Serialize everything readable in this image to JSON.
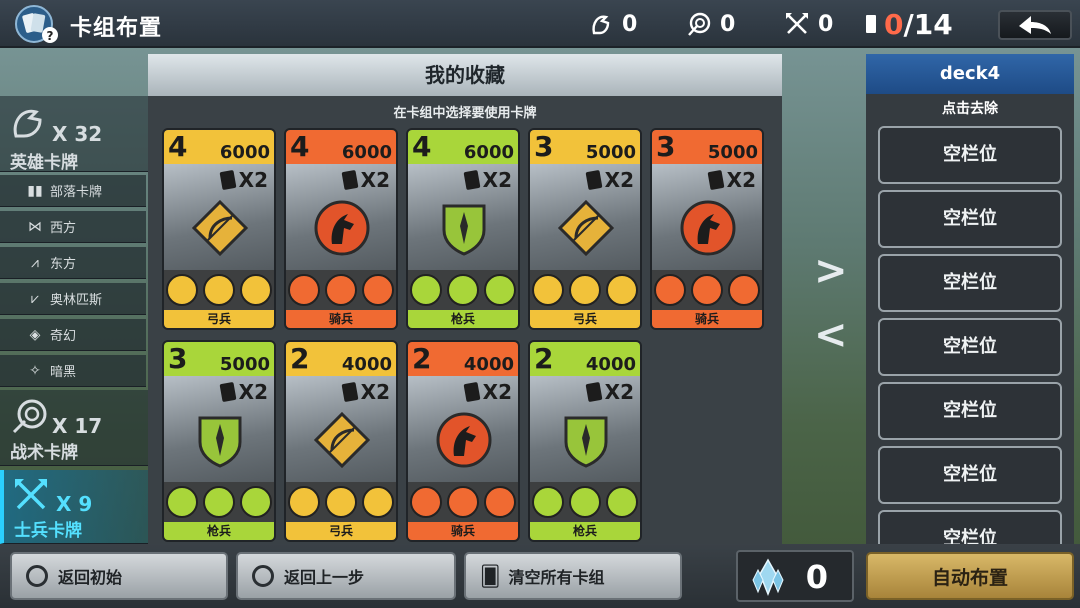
{
  "header": {
    "title": "卡组布置",
    "stats": [
      {
        "icon": "hero-icon",
        "value": "0"
      },
      {
        "icon": "tactic-icon",
        "value": "0"
      },
      {
        "icon": "soldier-icon",
        "value": "0"
      }
    ],
    "deck_count": {
      "current": "0",
      "total": "/14"
    }
  },
  "sidebar": {
    "hero": {
      "count": "X 32",
      "label": "英雄卡牌"
    },
    "factions": [
      {
        "icon": "tribe-icon",
        "label": "部落卡牌"
      },
      {
        "icon": "west-icon",
        "label": "西方"
      },
      {
        "icon": "east-icon",
        "label": "东方"
      },
      {
        "icon": "olympus-icon",
        "label": "奥林匹斯"
      },
      {
        "icon": "fantasy-icon",
        "label": "奇幻"
      },
      {
        "icon": "dark-icon",
        "label": "暗黑"
      }
    ],
    "tactic": {
      "count": "X 17",
      "label": "战术卡牌"
    },
    "soldier": {
      "count": "X 9",
      "label": "士兵卡牌"
    }
  },
  "collection": {
    "title": "我的收藏",
    "subtitle": "在卡组中选择要使用卡牌",
    "cards": [
      {
        "cost": "4",
        "power": "6000",
        "qty": "X2",
        "type": "弓兵",
        "color": "#f2c23a"
      },
      {
        "cost": "4",
        "power": "6000",
        "qty": "X2",
        "type": "骑兵",
        "color": "#f06a32"
      },
      {
        "cost": "4",
        "power": "6000",
        "qty": "X2",
        "type": "枪兵",
        "color": "#a9d63a"
      },
      {
        "cost": "3",
        "power": "5000",
        "qty": "X2",
        "type": "弓兵",
        "color": "#f2c23a"
      },
      {
        "cost": "3",
        "power": "5000",
        "qty": "X2",
        "type": "骑兵",
        "color": "#f06a32"
      },
      {
        "cost": "3",
        "power": "5000",
        "qty": "X2",
        "type": "枪兵",
        "color": "#a9d63a"
      },
      {
        "cost": "2",
        "power": "4000",
        "qty": "X2",
        "type": "弓兵",
        "color": "#f2c23a"
      },
      {
        "cost": "2",
        "power": "4000",
        "qty": "X2",
        "type": "骑兵",
        "color": "#f06a32"
      },
      {
        "cost": "2",
        "power": "4000",
        "qty": "X2",
        "type": "枪兵",
        "color": "#a9d63a"
      }
    ]
  },
  "deck": {
    "name": "deck4",
    "hint": "点击去除",
    "slots": [
      "空栏位",
      "空栏位",
      "空栏位",
      "空栏位",
      "空栏位",
      "空栏位",
      "空栏位"
    ]
  },
  "bottom": {
    "reset": "返回初始",
    "undo": "返回上一步",
    "clear": "清空所有卡组",
    "crystals": "0",
    "auto": "自动布置"
  },
  "colors": {
    "archer": "#f2c23a",
    "cavalry": "#f06a32",
    "spear": "#a9d63a",
    "accent": "#2ad0ff"
  }
}
